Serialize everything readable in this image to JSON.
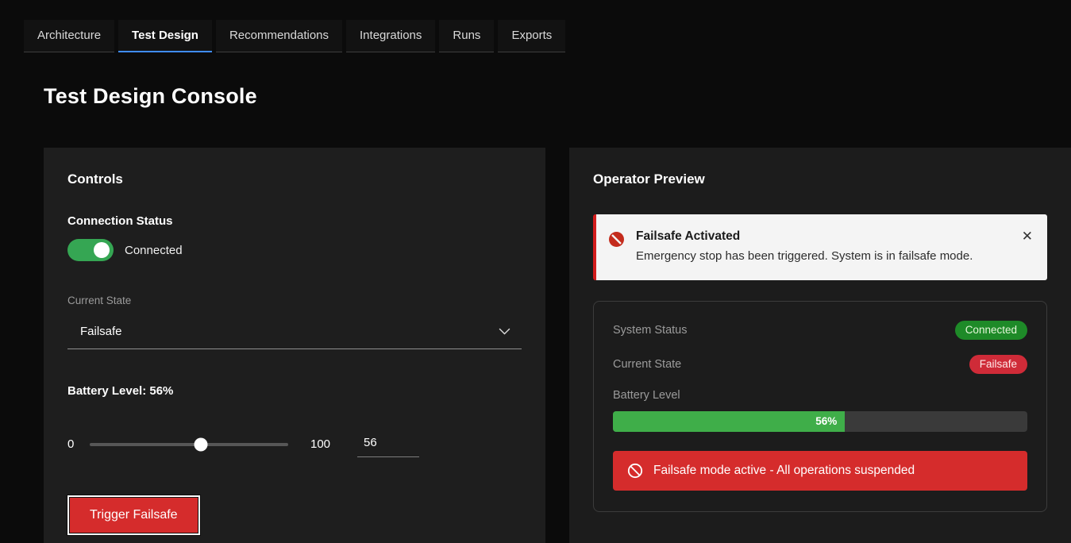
{
  "tabs": [
    {
      "label": "Architecture"
    },
    {
      "label": "Test Design"
    },
    {
      "label": "Recommendations"
    },
    {
      "label": "Integrations"
    },
    {
      "label": "Runs"
    },
    {
      "label": "Exports"
    }
  ],
  "page_title": "Test Design Console",
  "controls": {
    "title": "Controls",
    "connection_status_label": "Connection Status",
    "toggle_state_label": "Connected",
    "current_state_label": "Current State",
    "current_state_value": "Failsafe",
    "battery_label": "Battery Level: 56%",
    "slider_min": "0",
    "slider_max": "100",
    "slider_value": 56,
    "battery_input_value": "56",
    "trigger_button_label": "Trigger Failsafe"
  },
  "preview": {
    "title": "Operator Preview",
    "alert": {
      "title": "Failsafe Activated",
      "message": "Emergency stop has been triggered. System is in failsafe mode.",
      "close_label": "✕"
    },
    "status_card": {
      "system_status_label": "System Status",
      "system_status_badge": "Connected",
      "current_state_label": "Current State",
      "current_state_badge": "Failsafe",
      "battery_label": "Battery Level",
      "battery_percent": 56,
      "battery_percent_label": "56%",
      "banner_text": "Failsafe mode active - All operations suspended"
    }
  },
  "colors": {
    "accent_blue": "#3f8cff",
    "success_green": "#35a653",
    "danger_red": "#d52c2c",
    "badge_green": "#1e8a28",
    "badge_red": "#cf2b38"
  }
}
